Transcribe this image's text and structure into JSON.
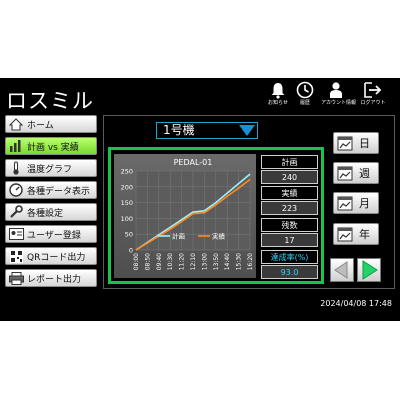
{
  "app": {
    "title": "ロスミル"
  },
  "topbar": [
    {
      "name": "notifications",
      "label": "お知らせ",
      "icon": "bell-icon"
    },
    {
      "name": "history",
      "label": "履歴",
      "icon": "clock-icon"
    },
    {
      "name": "account",
      "label": "アカウント情報",
      "icon": "user-icon"
    },
    {
      "name": "logout",
      "label": "ログアウト",
      "icon": "logout-icon"
    }
  ],
  "sidebar": {
    "items": [
      {
        "label": "ホーム",
        "icon": "home-icon"
      },
      {
        "label": "計画 vs 実績",
        "icon": "bar-chart-icon",
        "active": true
      },
      {
        "label": "温度グラフ",
        "icon": "thermometer-icon"
      },
      {
        "label": "各種データ表示",
        "icon": "gauge-icon"
      },
      {
        "label": "各種設定",
        "icon": "wrench-icon"
      },
      {
        "label": "ユーザー登録",
        "icon": "user-card-icon"
      },
      {
        "label": "QRコード出力",
        "icon": "qr-code-icon"
      },
      {
        "label": "レポート出力",
        "icon": "printer-icon"
      }
    ]
  },
  "machine_select": {
    "value": "1号機"
  },
  "stats": {
    "plan_label": "計画",
    "plan_value": "240",
    "actual_label": "実績",
    "actual_value": "223",
    "remaining_label": "残数",
    "remaining_value": "17",
    "rate_label": "達成率(%)",
    "rate_value": "93.0"
  },
  "periods": [
    {
      "label": "日",
      "icon": "calendar-icon"
    },
    {
      "label": "週",
      "icon": "calendar-icon"
    },
    {
      "label": "月",
      "icon": "calendar-icon"
    },
    {
      "label": "年",
      "icon": "calendar-icon"
    }
  ],
  "nav": {
    "prev_icon": "arrow-left-icon",
    "next_icon": "arrow-right-icon"
  },
  "datetime": "2024/04/08  17:48",
  "colors": {
    "plan": "#9ef0ff",
    "actual": "#ff8a1e",
    "accent": "#18c24b",
    "active_nav": "#8be03c"
  },
  "chart_data": {
    "type": "line",
    "title": "PEDAL-01",
    "xlabel": "",
    "ylabel": "",
    "ylim": [
      0,
      250
    ],
    "yticks": [
      "0",
      "50",
      "100",
      "150",
      "200",
      "250"
    ],
    "categories": [
      "08:00",
      "08:50",
      "09:40",
      "10:30",
      "11:20",
      "12:10",
      "13:00",
      "13:50",
      "14:40",
      "15:30",
      "16:20"
    ],
    "series": [
      {
        "name": "計画",
        "values": [
          0,
          24,
          48,
          72,
          96,
          120,
          124,
          150,
          180,
          210,
          240
        ],
        "color": "#9ef0ff"
      },
      {
        "name": "実績",
        "values": [
          0,
          22,
          44,
          66,
          90,
          115,
          118,
          143,
          170,
          196,
          223
        ],
        "color": "#ff8a1e"
      }
    ],
    "legend_position": "bottom-center",
    "grid": true
  }
}
